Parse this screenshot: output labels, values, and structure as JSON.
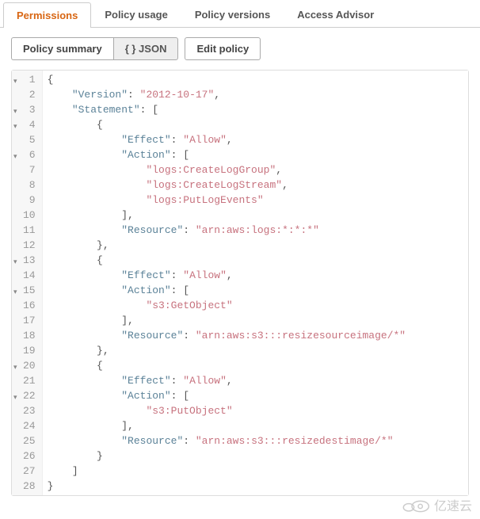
{
  "tabs": [
    {
      "label": "Permissions",
      "active": true
    },
    {
      "label": "Policy usage",
      "active": false
    },
    {
      "label": "Policy versions",
      "active": false
    },
    {
      "label": "Access Advisor",
      "active": false
    }
  ],
  "toolbar": {
    "policy_summary": "Policy summary",
    "json": "{ } JSON",
    "edit_policy": "Edit policy"
  },
  "code_lines": [
    {
      "n": 1,
      "fold": true,
      "i": 0,
      "segs": [
        {
          "t": "p",
          "v": "{"
        }
      ]
    },
    {
      "n": 2,
      "fold": false,
      "i": 1,
      "segs": [
        {
          "t": "k",
          "v": "\"Version\""
        },
        {
          "t": "p",
          "v": ": "
        },
        {
          "t": "s",
          "v": "\"2012-10-17\""
        },
        {
          "t": "p",
          "v": ","
        }
      ]
    },
    {
      "n": 3,
      "fold": true,
      "i": 1,
      "segs": [
        {
          "t": "k",
          "v": "\"Statement\""
        },
        {
          "t": "p",
          "v": ": ["
        }
      ]
    },
    {
      "n": 4,
      "fold": true,
      "i": 2,
      "segs": [
        {
          "t": "p",
          "v": "{"
        }
      ]
    },
    {
      "n": 5,
      "fold": false,
      "i": 3,
      "segs": [
        {
          "t": "k",
          "v": "\"Effect\""
        },
        {
          "t": "p",
          "v": ": "
        },
        {
          "t": "s",
          "v": "\"Allow\""
        },
        {
          "t": "p",
          "v": ","
        }
      ]
    },
    {
      "n": 6,
      "fold": true,
      "i": 3,
      "segs": [
        {
          "t": "k",
          "v": "\"Action\""
        },
        {
          "t": "p",
          "v": ": ["
        }
      ]
    },
    {
      "n": 7,
      "fold": false,
      "i": 4,
      "segs": [
        {
          "t": "s",
          "v": "\"logs:CreateLogGroup\""
        },
        {
          "t": "p",
          "v": ","
        }
      ]
    },
    {
      "n": 8,
      "fold": false,
      "i": 4,
      "segs": [
        {
          "t": "s",
          "v": "\"logs:CreateLogStream\""
        },
        {
          "t": "p",
          "v": ","
        }
      ]
    },
    {
      "n": 9,
      "fold": false,
      "i": 4,
      "segs": [
        {
          "t": "s",
          "v": "\"logs:PutLogEvents\""
        }
      ]
    },
    {
      "n": 10,
      "fold": false,
      "i": 3,
      "segs": [
        {
          "t": "p",
          "v": "],"
        }
      ]
    },
    {
      "n": 11,
      "fold": false,
      "i": 3,
      "segs": [
        {
          "t": "k",
          "v": "\"Resource\""
        },
        {
          "t": "p",
          "v": ": "
        },
        {
          "t": "s",
          "v": "\"arn:aws:logs:*:*:*\""
        }
      ]
    },
    {
      "n": 12,
      "fold": false,
      "i": 2,
      "segs": [
        {
          "t": "p",
          "v": "},"
        }
      ]
    },
    {
      "n": 13,
      "fold": true,
      "i": 2,
      "segs": [
        {
          "t": "p",
          "v": "{"
        }
      ]
    },
    {
      "n": 14,
      "fold": false,
      "i": 3,
      "segs": [
        {
          "t": "k",
          "v": "\"Effect\""
        },
        {
          "t": "p",
          "v": ": "
        },
        {
          "t": "s",
          "v": "\"Allow\""
        },
        {
          "t": "p",
          "v": ","
        }
      ]
    },
    {
      "n": 15,
      "fold": true,
      "i": 3,
      "segs": [
        {
          "t": "k",
          "v": "\"Action\""
        },
        {
          "t": "p",
          "v": ": ["
        }
      ]
    },
    {
      "n": 16,
      "fold": false,
      "i": 4,
      "segs": [
        {
          "t": "s",
          "v": "\"s3:GetObject\""
        }
      ]
    },
    {
      "n": 17,
      "fold": false,
      "i": 3,
      "segs": [
        {
          "t": "p",
          "v": "],"
        }
      ]
    },
    {
      "n": 18,
      "fold": false,
      "i": 3,
      "segs": [
        {
          "t": "k",
          "v": "\"Resource\""
        },
        {
          "t": "p",
          "v": ": "
        },
        {
          "t": "s",
          "v": "\"arn:aws:s3:::resizesourceimage/*\""
        }
      ]
    },
    {
      "n": 19,
      "fold": false,
      "i": 2,
      "segs": [
        {
          "t": "p",
          "v": "},"
        }
      ]
    },
    {
      "n": 20,
      "fold": true,
      "i": 2,
      "segs": [
        {
          "t": "p",
          "v": "{"
        }
      ]
    },
    {
      "n": 21,
      "fold": false,
      "i": 3,
      "segs": [
        {
          "t": "k",
          "v": "\"Effect\""
        },
        {
          "t": "p",
          "v": ": "
        },
        {
          "t": "s",
          "v": "\"Allow\""
        },
        {
          "t": "p",
          "v": ","
        }
      ]
    },
    {
      "n": 22,
      "fold": true,
      "i": 3,
      "segs": [
        {
          "t": "k",
          "v": "\"Action\""
        },
        {
          "t": "p",
          "v": ": ["
        }
      ]
    },
    {
      "n": 23,
      "fold": false,
      "i": 4,
      "segs": [
        {
          "t": "s",
          "v": "\"s3:PutObject\""
        }
      ]
    },
    {
      "n": 24,
      "fold": false,
      "i": 3,
      "segs": [
        {
          "t": "p",
          "v": "],"
        }
      ]
    },
    {
      "n": 25,
      "fold": false,
      "i": 3,
      "segs": [
        {
          "t": "k",
          "v": "\"Resource\""
        },
        {
          "t": "p",
          "v": ": "
        },
        {
          "t": "s",
          "v": "\"arn:aws:s3:::resizedestimage/*\""
        }
      ]
    },
    {
      "n": 26,
      "fold": false,
      "i": 2,
      "segs": [
        {
          "t": "p",
          "v": "}"
        }
      ]
    },
    {
      "n": 27,
      "fold": false,
      "i": 1,
      "segs": [
        {
          "t": "p",
          "v": "]"
        }
      ]
    },
    {
      "n": 28,
      "fold": false,
      "i": 0,
      "segs": [
        {
          "t": "p",
          "v": "}"
        }
      ]
    }
  ],
  "watermark_text": "亿速云"
}
